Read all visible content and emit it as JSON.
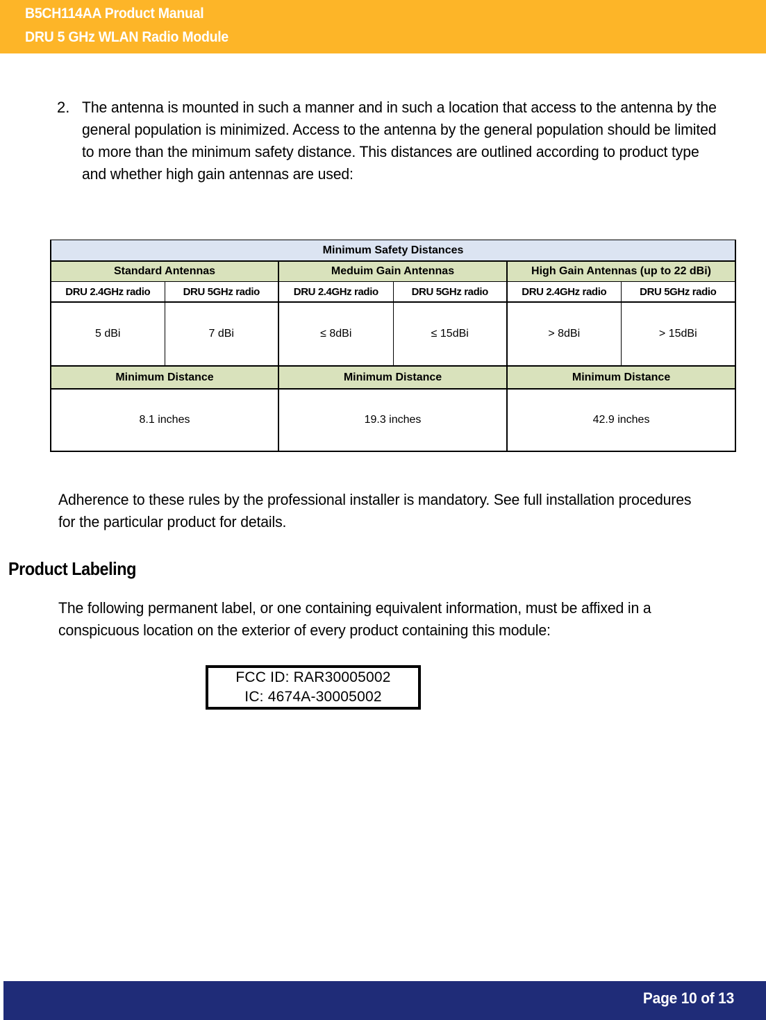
{
  "header": {
    "title_line1": "B5CH114AA Product Manual",
    "title_line2": "DRU 5 GHz WLAN Radio Module",
    "background_color": "#FDB528",
    "text_color": "#FFFFFF"
  },
  "body": {
    "list_item": {
      "marker": "2.",
      "text": "The antenna is mounted in such a manner and in such a location that access to the antenna by the general population is minimized.  Access to the antenna by the general population should be limited to more than the minimum safety distance.  This distances are outlined according to product type and whether high gain antennas are used:"
    },
    "paragraph_adherence": "Adherence to these rules by the professional installer is mandatory.  See full installation procedures for the particular product for details.",
    "section_heading": "Product Labeling",
    "paragraph_labeling": "The following permanent label, or one containing equivalent information, must be affixed in a conspicuous location on the exterior of every product containing this module:"
  },
  "table": {
    "title": "Minimum Safety Distances",
    "title_bg": "#DCE4F2",
    "group_bg": "#D9E2BC",
    "groups": [
      "Standard Antennas",
      "Meduim Gain Antennas",
      "High Gain Antennas (up to 22 dBi)"
    ],
    "radio_columns": [
      "DRU 2.4GHz radio",
      "DRU 5GHz radio",
      "DRU 2.4GHz radio",
      "DRU 5GHz radio",
      "DRU 2.4GHz radio",
      "DRU 5GHz radio"
    ],
    "gain_values": [
      "5 dBi",
      "7 dBi",
      "≤ 8dBi",
      "≤ 15dBi",
      "> 8dBi",
      "> 15dBi"
    ],
    "min_distance_labels": [
      "Minimum Distance",
      "Minimum Distance",
      "Minimum Distance"
    ],
    "distances": [
      "8.1 inches",
      "19.3 inches",
      "42.9 inches"
    ]
  },
  "fcc_label": {
    "line1": "FCC ID: RAR30005002",
    "line2": "IC:  4674A-30005002"
  },
  "footer": {
    "page_text": "Page 10 of 13",
    "background_color": "#1F2C78",
    "text_color": "#FFFFFF"
  }
}
